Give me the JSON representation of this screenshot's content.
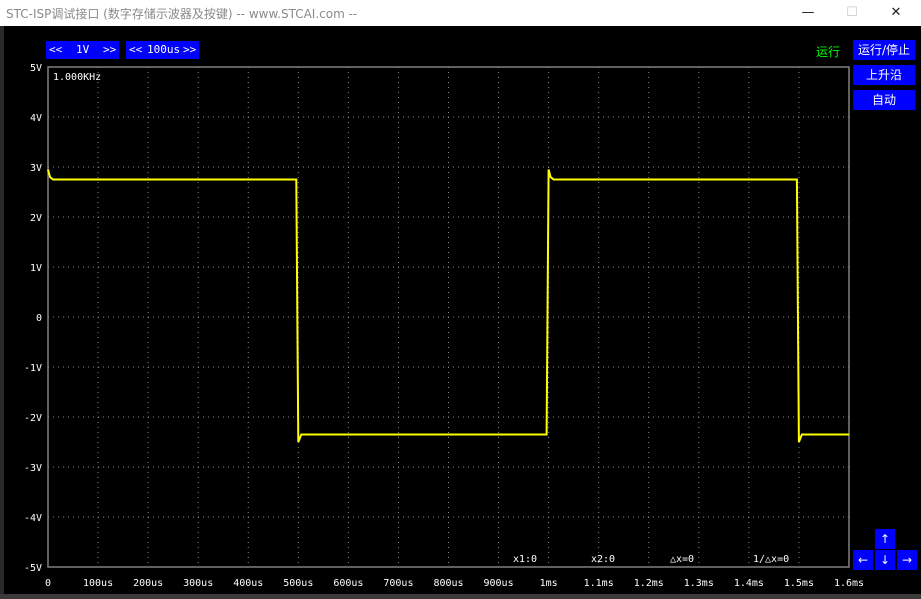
{
  "window": {
    "title": "STC-ISP调试接口 (数字存储示波器及按键) -- www.STCAI.com --",
    "minimize_glyph": "—",
    "maximize_glyph": "☐",
    "close_glyph": "✕"
  },
  "controls": {
    "volt_prev": "<<",
    "volt_value": "1V",
    "volt_next": ">>",
    "time_prev": "<<",
    "time_value": "100us",
    "time_next": ">>",
    "status": "运行",
    "run_stop": "运行/停止",
    "trigger_edge": "上升沿",
    "auto": "自动",
    "arrow_up": "↑",
    "arrow_left": "←",
    "arrow_down": "↓",
    "arrow_right": "→"
  },
  "scope": {
    "frequency": "1.000KHz",
    "cursor_x1": "x1:0",
    "cursor_x2": "x2:0",
    "delta_x": "△x=0",
    "inv_delta_x": "1/△x=0"
  },
  "chart_data": {
    "type": "line",
    "title": "",
    "xlabel": "",
    "ylabel": "",
    "xlim": [
      0,
      1600
    ],
    "ylim": [
      -5,
      5
    ],
    "grid": true,
    "y_tick_labels": [
      "5V",
      "4V",
      "3V",
      "2V",
      "1V",
      "0",
      "-1V",
      "-2V",
      "-3V",
      "-4V",
      "-5V"
    ],
    "y_tick_values": [
      5,
      4,
      3,
      2,
      1,
      0,
      -1,
      -2,
      -3,
      -4,
      -5
    ],
    "x_tick_labels": [
      "0",
      "100us",
      "200us",
      "300us",
      "400us",
      "500us",
      "600us",
      "700us",
      "800us",
      "900us",
      "1ms",
      "1.1ms",
      "1.2ms",
      "1.3ms",
      "1.4ms",
      "1.5ms",
      "1.6ms"
    ],
    "x_tick_values": [
      0,
      100,
      200,
      300,
      400,
      500,
      600,
      700,
      800,
      900,
      1000,
      1100,
      1200,
      1300,
      1400,
      1500,
      1600
    ],
    "series": [
      {
        "color": "#ffff00",
        "x": [
          0,
          4,
          10,
          490,
          496,
          500,
          506,
          520,
          990,
          996,
          1000,
          1004,
          1010,
          1490,
          1496,
          1500,
          1506,
          1520,
          1600
        ],
        "y": [
          2.95,
          2.8,
          2.75,
          2.75,
          2.75,
          -2.5,
          -2.35,
          -2.35,
          -2.35,
          -2.35,
          2.95,
          2.8,
          2.75,
          2.75,
          2.75,
          -2.5,
          -2.35,
          -2.35,
          -2.35
        ]
      }
    ]
  }
}
